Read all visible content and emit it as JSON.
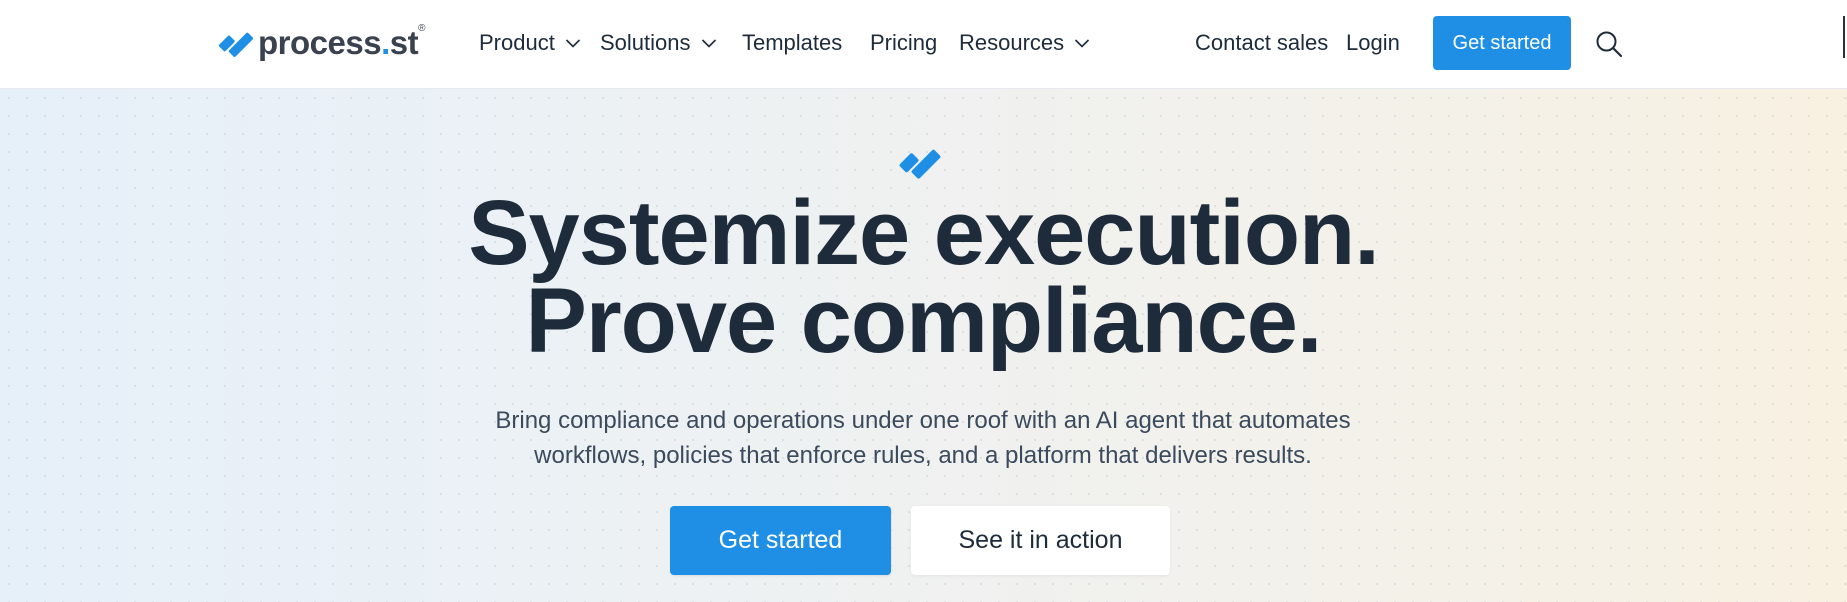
{
  "brand": {
    "name": "process",
    "dot": ".",
    "suffix": "st",
    "registered": "®",
    "accent_color": "#1f8fe5",
    "text_color": "#3a4250"
  },
  "nav": {
    "items": [
      {
        "label": "Product",
        "has_dropdown": true
      },
      {
        "label": "Solutions",
        "has_dropdown": true
      },
      {
        "label": "Templates",
        "has_dropdown": false
      },
      {
        "label": "Pricing",
        "has_dropdown": false
      },
      {
        "label": "Resources",
        "has_dropdown": true
      }
    ],
    "contact_sales": "Contact sales",
    "login": "Login",
    "get_started": "Get started",
    "search_icon": "search-icon"
  },
  "hero": {
    "headline_line1": "Systemize execution.",
    "headline_line2": "Prove compliance.",
    "subtext_line1": "Bring compliance and operations under one roof with an AI agent that automates",
    "subtext_line2": "workflows, policies that enforce rules, and a platform that delivers results.",
    "primary_cta": "Get started",
    "secondary_cta": "See it in action"
  },
  "colors": {
    "primary": "#1f8fe5",
    "heading": "#1d2b3a",
    "body_text": "#3b4a5c"
  }
}
